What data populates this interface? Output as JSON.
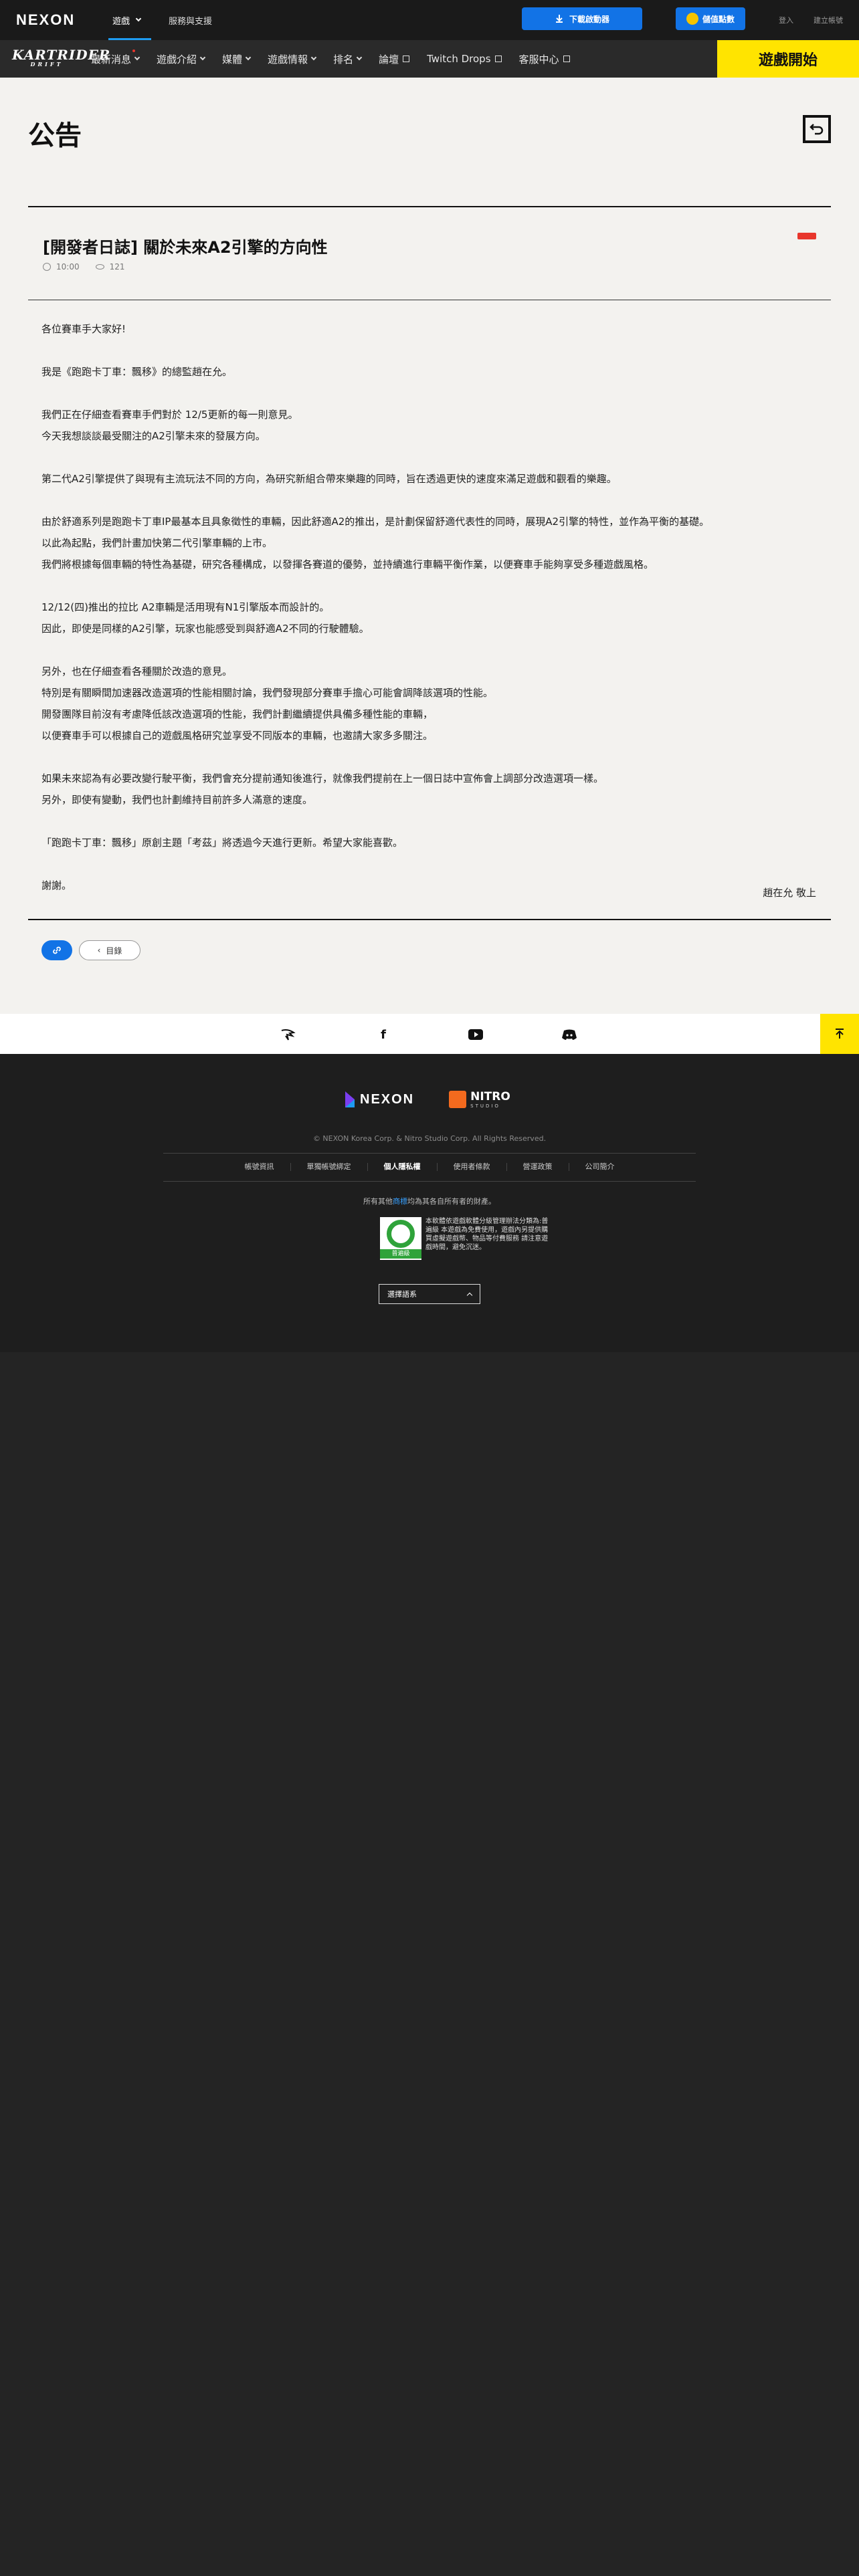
{
  "topbar": {
    "logo": "NEXON",
    "games_label": "遊戲",
    "support_label": "服務與支援",
    "download_label": "下載啟動器",
    "points_label": "儲值點數",
    "login_label": "登入",
    "register_label": "建立帳號"
  },
  "gamenav": {
    "logo": "KARTRIDER",
    "logo_sub": "DRIFT",
    "items": [
      {
        "label": "最新消息"
      },
      {
        "label": "遊戲介紹"
      },
      {
        "label": "媒體"
      },
      {
        "label": "遊戲情報"
      },
      {
        "label": "排名"
      },
      {
        "label": "論壇"
      },
      {
        "label": "Twitch Drops"
      },
      {
        "label": "客服中心"
      }
    ],
    "play_label": "遊戲開始"
  },
  "page": {
    "title": "公告",
    "post_title": "[開發者日誌] 關於未來A2引擎的方向性",
    "time": "10:00",
    "views": "121",
    "paragraphs": [
      [
        "各位賽車手大家好!"
      ],
      [
        "我是《跑跑卡丁車：飄移》的總監趙在允。"
      ],
      [
        "我們正在仔細查看賽車手們對於 12/5更新的每一則意見。",
        "今天我想談談最受關注的A2引擎未來的發展方向。"
      ],
      [
        "第二代A2引擎提供了與現有主流玩法不同的方向，為研究新組合帶來樂趣的同時，旨在透過更快的速度來滿足遊戲和觀看的樂趣。"
      ],
      [
        "由於舒適系列是跑跑卡丁車IP最基本且具象徵性的車輛，因此舒適A2的推出，是計劃保留舒適代表性的同時，展現A2引擎的特性，並作為平衡的基礎。",
        "以此為起點，我們計畫加快第二代引擎車輛的上市。",
        "我們將根據每個車輛的特性為基礎，研究各種構成，以發揮各賽道的優勢，並持續進行車輛平衡作業，以便賽車手能夠享受多種遊戲風格。"
      ],
      [
        "12/12(四)推出的拉比 A2車輛是活用現有N1引擎版本而設計的。",
        "因此，即使是同樣的A2引擎，玩家也能感受到與舒適A2不同的行駛體驗。"
      ],
      [
        "另外，也在仔細查看各種關於改造的意見。",
        "特別是有關瞬間加速器改造選項的性能相關討論，我們發現部分賽車手擔心可能會調降該選項的性能。",
        "開發團隊目前沒有考慮降低該改造選項的性能，我們計劃繼續提供具備多種性能的車輛，",
        "以便賽車手可以根據自己的遊戲風格研究並享受不同版本的車輛，也邀請大家多多關注。"
      ],
      [
        "如果未來認為有必要改變行駛平衡，我們會充分提前通知後進行，就像我們提前在上一個日誌中宣佈會上調部分改造選項一樣。",
        "另外，即使有變動，我們也計劃維持目前許多人滿意的速度。"
      ],
      [
        "「跑跑卡丁車：飄移」原創主題「考茲」將透過今天進行更新。希望大家能喜歡。"
      ],
      [
        "謝謝。"
      ]
    ],
    "signature": "趙在允 敬上",
    "list_button": "目錄"
  },
  "social": {
    "icons": [
      "kartrider-icon",
      "facebook-icon",
      "youtube-icon",
      "discord-icon"
    ]
  },
  "footer": {
    "nexon": "NEXON",
    "nitro": "NITRO",
    "nitro_sub": "STUDIO",
    "copyright": "© NEXON Korea Corp. & Nitro Studio Corp. All Rights Reserved.",
    "links": [
      "帳號資訊",
      "單獨帳號綁定",
      "個人隱私權",
      "使用者條款",
      "營運政策",
      "公司簡介"
    ],
    "trademark_prefix": "所有其他",
    "trademark_highlight": "商標",
    "trademark_suffix": "均為其各自所有者的財產。",
    "rating_label": "普遍級",
    "rating_text": "本軟體依遊戲軟體分級管理辦法分類為:普遍級 本遊戲為免費使用，遊戲內另提供購買虛擬遊戲幣、物品等付費服務 請注意遊戲時間，避免沉迷。",
    "lang_label": "選擇語系"
  },
  "colors": {
    "accent_blue": "#1273e6",
    "play_yellow": "#ffe400",
    "new_red": "#e8362c"
  }
}
